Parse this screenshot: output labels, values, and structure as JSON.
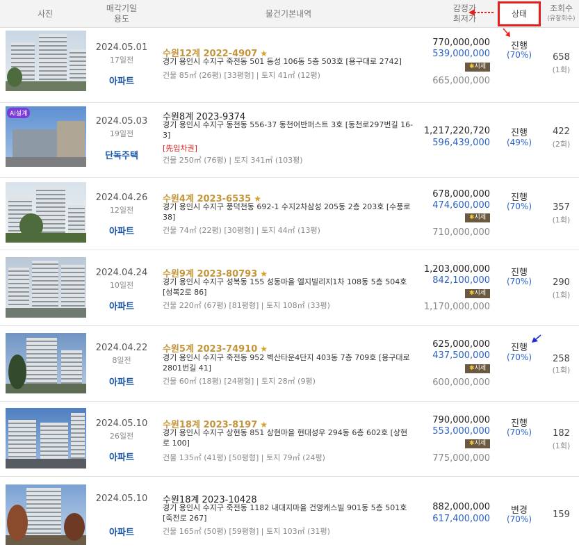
{
  "header": {
    "photo": "사진",
    "date_line1": "매각기일",
    "date_line2": "용도",
    "info": "물건기본내역",
    "price_line1": "감정가",
    "price_line2": "최저가",
    "status": "상태",
    "views_line1": "조회수",
    "views_line2": "(유찰회수)"
  },
  "market_label": "시세",
  "rows": [
    {
      "ai_badge": "",
      "date": "2024.05.01",
      "days": "17일전",
      "usage": "아파트",
      "case": "수원12계 2022-4907",
      "starred": true,
      "address": "경기 용인시 수지구 죽전동 501 동성 106동 5층 503호 [용구대로 2742]",
      "tag": "",
      "area": "건물 85㎡ (26평) [33평형]  |  토지 41㎡ (12평)",
      "appraisal": "770,000,000",
      "minimum": "539,000,000",
      "sale": "665,000,000",
      "status": "진행",
      "pct": "(70%)",
      "views": "658",
      "fails": "(1회)"
    },
    {
      "ai_badge": "AI설계",
      "date": "2024.05.03",
      "days": "19일전",
      "usage": "단독주택",
      "case": "수원8계 2023-9374",
      "starred": false,
      "address": "경기 용인시 수지구 동천동 556-37 동천어반퍼스트 3호 [동천로297번길 16-3]",
      "tag": "[先입차권]",
      "area": "건물 250㎡ (76평)  |  토지 341㎡ (103평)",
      "appraisal": "1,217,220,720",
      "minimum": "596,439,000",
      "sale": "",
      "status": "진행",
      "pct": "(49%)",
      "views": "422",
      "fails": "(2회)"
    },
    {
      "ai_badge": "",
      "date": "2024.04.26",
      "days": "12일전",
      "usage": "아파트",
      "case": "수원4계 2023-6535",
      "starred": true,
      "address": "경기 용인시 수지구 풍덕천동 692-1 수지2차삼성 205동 2층 203호 [수풍로 38]",
      "tag": "",
      "area": "건물 74㎡ (22평) [30평형]  |  토지 44㎡ (13평)",
      "appraisal": "678,000,000",
      "minimum": "474,600,000",
      "sale": "710,000,000",
      "status": "진행",
      "pct": "(70%)",
      "views": "357",
      "fails": "(1회)"
    },
    {
      "ai_badge": "",
      "date": "2024.04.24",
      "days": "10일전",
      "usage": "아파트",
      "case": "수원9계 2023-80793",
      "starred": true,
      "address": "경기 용인시 수지구 성복동 155 성동마을 엘지빌리지1차 108동 5층 504호 [성복2로 86]",
      "tag": "",
      "area": "건물 220㎡ (67평) [81평형]  |  토지 108㎡ (33평)",
      "appraisal": "1,203,000,000",
      "minimum": "842,100,000",
      "sale": "1,170,000,000",
      "status": "진행",
      "pct": "(70%)",
      "views": "290",
      "fails": "(1회)"
    },
    {
      "ai_badge": "",
      "date": "2024.04.22",
      "days": "8일전",
      "usage": "아파트",
      "case": "수원5계 2023-74910",
      "starred": true,
      "address": "경기 용인시 수지구 죽전동 952 벽산타운4단지 403동 7층 709호 [용구대로2801번길 41]",
      "tag": "",
      "area": "건물 60㎡ (18평) [24평형]  |  토지 28㎡ (9평)",
      "appraisal": "625,000,000",
      "minimum": "437,500,000",
      "sale": "600,000,000",
      "status": "진행",
      "pct": "(70%)",
      "views": "258",
      "fails": "(1회)"
    },
    {
      "ai_badge": "",
      "date": "2024.05.10",
      "days": "26일전",
      "usage": "아파트",
      "case": "수원18계 2023-8197",
      "starred": true,
      "address": "경기 용인시 수지구 상현동 851 상현마을 현대성우 294동 6층 602호 [상현로 100]",
      "tag": "",
      "area": "건물 135㎡ (41평) [50평형]  |  토지 79㎡ (24평)",
      "appraisal": "790,000,000",
      "minimum": "553,000,000",
      "sale": "775,000,000",
      "status": "진행",
      "pct": "(70%)",
      "views": "182",
      "fails": "(1회)"
    },
    {
      "ai_badge": "",
      "date": "2024.05.10",
      "days": "",
      "usage": "아파트",
      "case": "수원18계 2023-10428",
      "starred": false,
      "address": "경기 용인시 수지구 죽전동 1182 내대지마을 건영캐스빌 901동 5층 501호 [죽전로 267]",
      "tag": "",
      "area": "건물 165㎡ (50평) [59평형]  |  토지 103㎡ (31평)",
      "appraisal": "882,000,000",
      "minimum": "617,400,000",
      "sale": "",
      "status": "변경",
      "pct": "(70%)",
      "views": "159",
      "fails": ""
    }
  ]
}
